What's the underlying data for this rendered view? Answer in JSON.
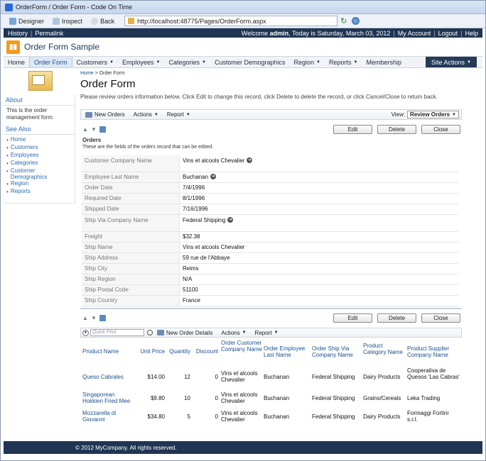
{
  "window": {
    "title": "OrderForm / Order Form - Code On Time"
  },
  "browser": {
    "designer": "Designer",
    "inspect": "Inspect",
    "back": "Back",
    "url": "http://localhost:48775/Pages/OrderForm.aspx"
  },
  "topbar": {
    "history": "History",
    "permalink": "Permalink",
    "welcome_prefix": "Welcome",
    "user": "admin",
    "date_text": ", Today is Saturday, March 03, 2012",
    "my_account": "My Account",
    "logout": "Logout",
    "help": "Help"
  },
  "app": {
    "title": "Order Form Sample"
  },
  "menu": {
    "items": [
      "Home",
      "Order Form",
      "Customers",
      "Employees",
      "Categories",
      "Customer Demographics",
      "Region",
      "Reports",
      "Membership"
    ],
    "site_actions": "Site Actions"
  },
  "sidebar": {
    "about_title": "About",
    "about_text": "This is the order management form.",
    "see_also_title": "See Also",
    "links": [
      "Home",
      "Customers",
      "Employees",
      "Categories",
      "Customer Demographics",
      "Region",
      "Reports"
    ]
  },
  "main": {
    "crumb_home": "Home",
    "crumb_sep": " > ",
    "crumb_current": "Order Form",
    "title": "Order Form",
    "description": "Please review orders information below. Click Edit to change this record, click Delete to delete the record, or click Cancel/Close to return back."
  },
  "actionbar": {
    "new": "New Orders",
    "actions": "Actions",
    "report": "Report",
    "view_label": "View:",
    "view_value": "Review Orders"
  },
  "form": {
    "edit": "Edit",
    "delete": "Delete",
    "close": "Close",
    "section_title": "Orders",
    "section_desc": "These are the fields of the orders record that can be edited.",
    "fields": [
      {
        "label": "Customer Company Name",
        "value": "Vins et alcools Chevalier",
        "link": true
      },
      {
        "label": "Employee Last Name",
        "value": "Buchanan",
        "link": true
      },
      {
        "label": "Order Date",
        "value": "7/4/1996",
        "link": false
      },
      {
        "label": "Required Date",
        "value": "8/1/1996",
        "link": false
      },
      {
        "label": "Shipped Date",
        "value": "7/16/1996",
        "link": false
      },
      {
        "label": "Ship Via Company Name",
        "value": "Federal Shipping",
        "link": true
      },
      {
        "label": "Freight",
        "value": "$32.38",
        "link": false
      },
      {
        "label": "Ship Name",
        "value": "Vins et alcools Chevalier",
        "link": false
      },
      {
        "label": "Ship Address",
        "value": "59 rue de l'Abbaye",
        "link": false
      },
      {
        "label": "Ship City",
        "value": "Reims",
        "link": false
      },
      {
        "label": "Ship Region",
        "value": "N/A",
        "link": false
      },
      {
        "label": "Ship Postal Code",
        "value": "51100",
        "link": false
      },
      {
        "label": "Ship Country",
        "value": "France",
        "link": false
      }
    ]
  },
  "grid": {
    "quick_find": "Quick Find",
    "new": "New Order Details",
    "actions": "Actions",
    "report": "Report",
    "headers": [
      "Product Name",
      "Unit Price",
      "Quantity",
      "Discount",
      "Order Customer Company Name",
      "Order Employee Last Name",
      "Order Ship Via Company Name",
      "Product Category Name",
      "Product Supplier Company Name"
    ],
    "rows": [
      [
        "Queso Cabrales",
        "$14.00",
        "12",
        "0",
        "Vins et alcools Chevalier",
        "Buchanan",
        "Federal Shipping",
        "Dairy Products",
        "Cooperativa de Quesos 'Las Cabras'"
      ],
      [
        "Singaporean Hokkien Fried Mee",
        "$9.80",
        "10",
        "0",
        "Vins et alcools Chevalier",
        "Buchanan",
        "Federal Shipping",
        "Grains/Cereals",
        "Leka Trading"
      ],
      [
        "Mozzarella di Giovanni",
        "$34.80",
        "5",
        "0",
        "Vins et alcools Chevalier",
        "Buchanan",
        "Federal Shipping",
        "Dairy Products",
        "Formaggi Fortini s.r.l."
      ]
    ]
  },
  "footer": {
    "text": "© 2012 MyCompany. All rights reserved."
  },
  "colors": {
    "topbar": "#1f3553",
    "link": "#1a4f8f",
    "logo": "#f39a1a"
  }
}
